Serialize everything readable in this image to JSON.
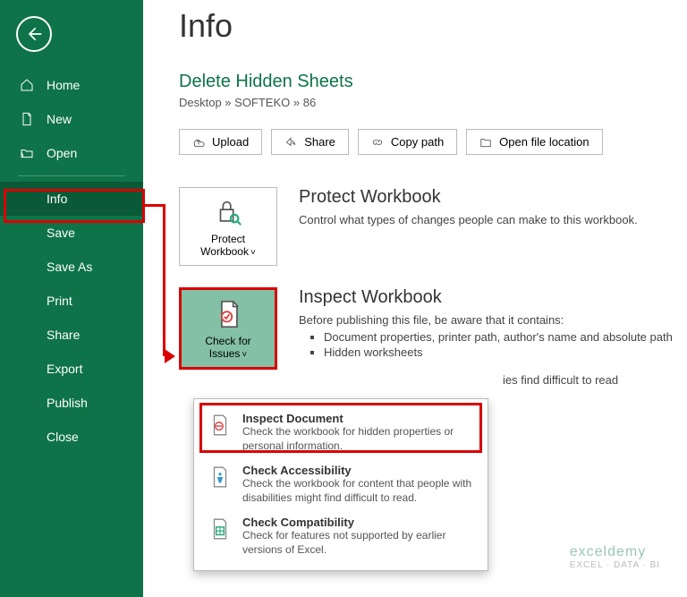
{
  "sidebar": {
    "items": [
      "Home",
      "New",
      "Open",
      "Info",
      "Save",
      "Save As",
      "Print",
      "Share",
      "Export",
      "Publish",
      "Close"
    ]
  },
  "page": {
    "title": "Info",
    "doc": "Delete Hidden Sheets",
    "crumb": "Desktop » SOFTEKO » 86"
  },
  "actions": [
    "Upload",
    "Share",
    "Copy path",
    "Open file location"
  ],
  "protect": {
    "btn": "Protect Workbook",
    "h": "Protect Workbook",
    "p": "Control what types of changes people can make to this workbook."
  },
  "inspect": {
    "btn": "Check for Issues",
    "h": "Inspect Workbook",
    "p": "Before publishing this file, be aware that it contains:",
    "li1": "Document properties, printer path, author's name and absolute path",
    "li2": "Hidden worksheets",
    "li3_tail": "ies find difficult to read"
  },
  "dd": {
    "a": {
      "t": "Inspect Document",
      "d": "Check the workbook for hidden properties or personal information."
    },
    "b": {
      "t": "Check Accessibility",
      "d": "Check the workbook for content that people with disabilities might find difficult to read."
    },
    "c": {
      "t": "Check Compatibility",
      "d": "Check for features not supported by earlier versions of Excel."
    }
  },
  "wm": {
    "a": "exceldemy",
    "b": "EXCEL · DATA · BI"
  }
}
